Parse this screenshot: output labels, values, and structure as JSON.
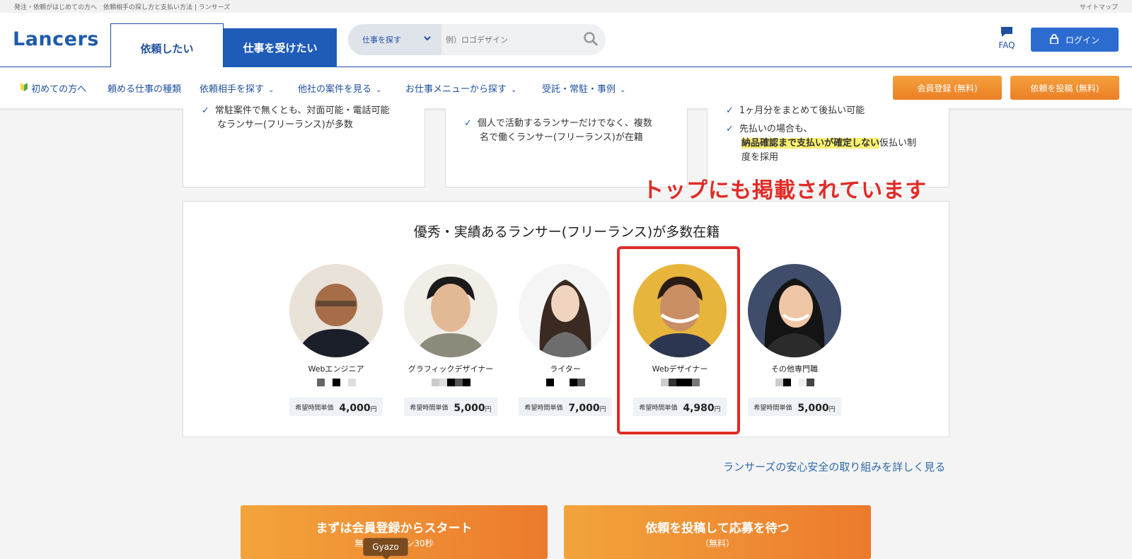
{
  "topstrip": {
    "left": "発注・依頼がはじめての方へ　依頼相手の探し方と支払い方法 | ランサーズ",
    "right": "サイトマップ"
  },
  "header": {
    "logo": "Lancers",
    "tab_client": "依頼したい",
    "tab_worker": "仕事を受けたい",
    "search_category": "仕事を探す",
    "search_placeholder": "例）ロゴデザイン",
    "faq": "FAQ",
    "login": "ログイン"
  },
  "nav": {
    "items": [
      "初めての方へ",
      "頼める仕事の種類",
      "依頼相手を探す",
      "他社の案件を見る",
      "お仕事メニューから探す",
      "受託・常駐・事例"
    ],
    "register": "会員登録 (無料)",
    "post_job": "依頼を投稿 (無料)"
  },
  "features": {
    "col1": [
      "常駐案件で無くとも、対面可能・電話可能",
      "なランサー(フリーランス)が多数"
    ],
    "col2": [
      "個人で活動するランサーだけでなく、複数",
      "名で働くランサー(フリーランス)が在籍"
    ],
    "col3_top": "1ヶ月分をまとめて後払い可能",
    "col3_a": "先払いの場合も、",
    "col3_highlight": "納品確認まで支払いが確定しない",
    "col3_b": "仮払い制",
    "col3_c": "度を採用"
  },
  "annotation": "トップにも掲載されています",
  "lancers_section": {
    "title": "優秀・実績あるランサー(フリーランス)が多数在籍",
    "rate_label": "希望時間単価",
    "yen": "円",
    "lancers": [
      {
        "role": "Webエンジニア",
        "rate": "4,000"
      },
      {
        "role": "グラフィックデザイナー",
        "rate": "5,000"
      },
      {
        "role": "ライター",
        "rate": "7,000"
      },
      {
        "role": "Webデザイナー",
        "rate": "4,980"
      },
      {
        "role": "その他専門職",
        "rate": "5,000"
      }
    ]
  },
  "safety_link": "ランサーズの安心安全の取り組みを詳しく見る",
  "cta": {
    "left_title": "まずは会員登録からスタート",
    "left_sub": "無料・カンタン30秒",
    "right_title": "依頼を投稿して応募を待つ",
    "right_sub": "（無料）"
  },
  "gyazo": "Gyazo"
}
